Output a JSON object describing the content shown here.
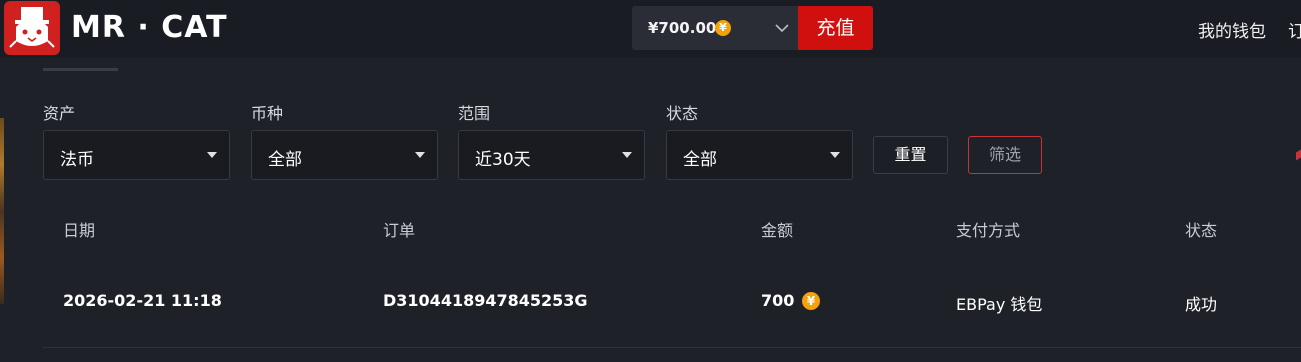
{
  "header": {
    "logo_text": "MR · CAT",
    "balance": "¥700.00",
    "coin_symbol": "¥",
    "recharge_label": "充值",
    "nav_wallet": "我的钱包",
    "nav_cut": "订"
  },
  "filters": {
    "asset": {
      "label": "资产",
      "value": "法币"
    },
    "currency": {
      "label": "币种",
      "value": "全部"
    },
    "range": {
      "label": "范围",
      "value": "近30天"
    },
    "status": {
      "label": "状态",
      "value": "全部"
    },
    "reset_label": "重置",
    "filter_label": "筛选"
  },
  "table": {
    "headers": [
      "日期",
      "订单",
      "金额",
      "支付方式",
      "状态"
    ],
    "rows": [
      {
        "date": "2026-02-21 11:18",
        "order": "D3104418947845253G",
        "amount": "700",
        "coin_symbol": "¥",
        "payment": "EBPay 钱包",
        "status": "成功"
      }
    ]
  },
  "colors": {
    "accent_red": "#d0100f",
    "coin_gold": "#f5a20a",
    "background": "#1f2129",
    "topbar": "#1a1c23"
  },
  "icons": {
    "logo": "cat-top-hat-logo",
    "coin": "yuan-coin-icon",
    "chevron": "chevron-down-icon",
    "caret": "caret-down-icon"
  }
}
